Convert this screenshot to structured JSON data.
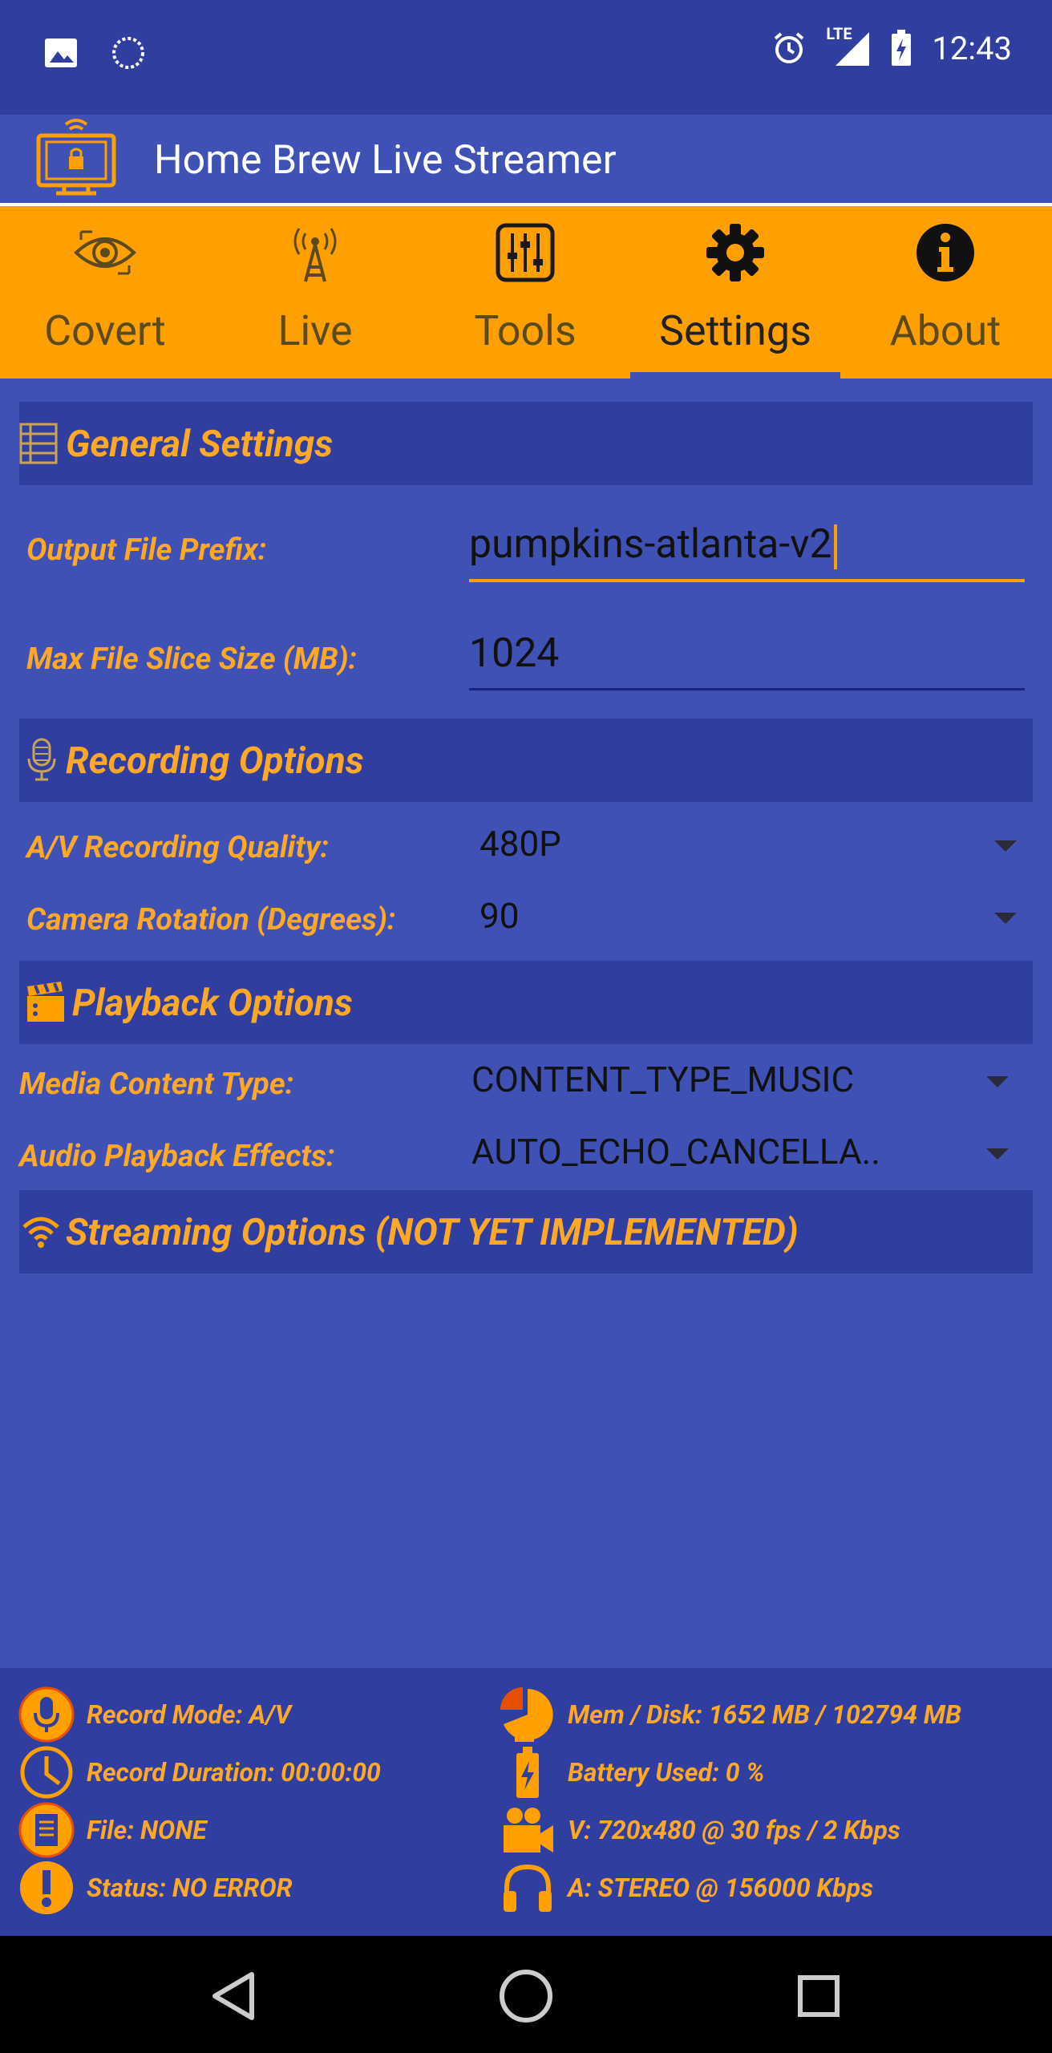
{
  "status_bar": {
    "time": "12:43",
    "network": "LTE"
  },
  "app": {
    "title": "Home Brew Live Streamer"
  },
  "tabs": [
    {
      "label": "Covert",
      "icon": "eye-icon"
    },
    {
      "label": "Live",
      "icon": "antenna-icon"
    },
    {
      "label": "Tools",
      "icon": "sliders-icon"
    },
    {
      "label": "Settings",
      "icon": "gear-icon",
      "active": true
    },
    {
      "label": "About",
      "icon": "info-icon"
    }
  ],
  "general": {
    "title": "General Settings",
    "prefix_label": "Output File Prefix:",
    "prefix_value": "pumpkins-atlanta-v2",
    "slice_label": "Max File Slice Size (MB):",
    "slice_value": "1024"
  },
  "recording": {
    "title": "Recording Options",
    "quality_label": "A/V Recording Quality:",
    "quality_value": "480P",
    "rotation_label": "Camera Rotation (Degrees):",
    "rotation_value": "90"
  },
  "playback": {
    "title": "Playback Options",
    "content_label": "Media Content Type:",
    "content_value": "CONTENT_TYPE_MUSIC",
    "effects_label": "Audio Playback Effects:",
    "effects_value": "AUTO_ECHO_CANCELLA.."
  },
  "streaming": {
    "title": "Streaming Options (NOT YET IMPLEMENTED)"
  },
  "footer": {
    "record_mode": "Record Mode: A/V",
    "record_duration": "Record Duration: 00:00:00",
    "file": "File: NONE",
    "status": "Status: NO ERROR",
    "mem_disk": "Mem / Disk: 1652 MB / 102794 MB",
    "battery": "Battery Used: 0 %",
    "video": "V: 720x480 @ 30 fps / 2 Kbps",
    "audio": "A: STEREO @ 156000 Kbps"
  },
  "colors": {
    "primary": "#3f51b5",
    "primary_dark": "#303f9f",
    "accent": "#ffa000",
    "label": "#ffa726"
  }
}
